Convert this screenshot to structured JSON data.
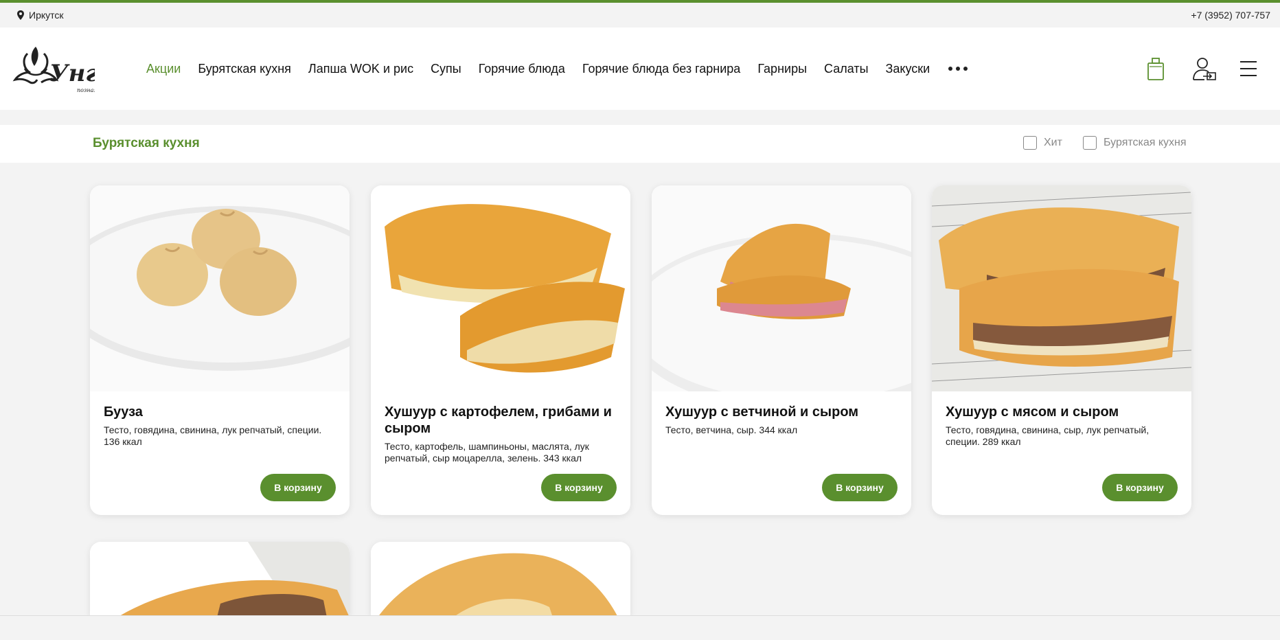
{
  "topbar": {
    "city": "Иркутск",
    "phone": "+7 (3952) 707-757"
  },
  "brand": {
    "logo_text": "Унгá",
    "logo_sub": "позная"
  },
  "nav": {
    "items": [
      {
        "label": "Акции",
        "active": true
      },
      {
        "label": "Бурятская кухня"
      },
      {
        "label": "Лапша WOK и рис"
      },
      {
        "label": "Супы"
      },
      {
        "label": "Горячие блюда"
      },
      {
        "label": "Горячие блюда без гарнира"
      },
      {
        "label": "Гарниры"
      },
      {
        "label": "Салаты"
      },
      {
        "label": "Закуски"
      }
    ],
    "more_icon": "ellipsis-icon"
  },
  "header_icons": [
    "cart-icon",
    "user-login-icon",
    "menu-icon"
  ],
  "category": {
    "title": "Бурятская кухня",
    "filters": [
      {
        "label": "Хит",
        "checked": false
      },
      {
        "label": "Бурятская кухня",
        "checked": false
      }
    ]
  },
  "products": [
    {
      "name": "Бууза",
      "description": "Тесто, говядина, свинина, лук репчатый, специи. 136 ккал",
      "button": "В корзину"
    },
    {
      "name": "Хушуур с картофелем, грибами и сыром",
      "description": "Тесто, картофель, шампиньоны, маслята, лук репчатый, сыр моцарелла, зелень. 343 ккал",
      "button": "В корзину"
    },
    {
      "name": "Хушуур с ветчиной и сыром",
      "description": "Тесто, ветчина, сыр. 344 ккал",
      "button": "В корзину"
    },
    {
      "name": "Хушуур с мясом и сыром",
      "description": "Тесто, говядина, свинина, сыр, лук репчатый, специи. 289 ккал",
      "button": "В корзину"
    }
  ],
  "colors": {
    "accent": "#5a8f2e",
    "background": "#f3f3f3",
    "card": "#ffffff"
  }
}
